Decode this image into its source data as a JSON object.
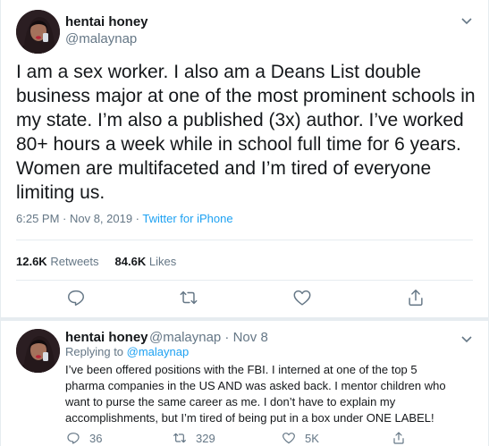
{
  "main_tweet": {
    "display_name": "hentai honey",
    "handle": "@malaynap",
    "text_lines": [
      "I am a sex worker. I also am a Deans List double",
      "business major at one of the most prominent schools in",
      "my state. I’m also a published (3x) author. I’ve worked",
      "80+ hours a week while in school full time for 6 years.",
      "Women are multifaceted and I’m tired of everyone",
      "limiting us."
    ],
    "time": "6:25 PM · Nov 8, 2019 · ",
    "source": "Twitter for iPhone",
    "retweets_count": "12.6K",
    "retweets_label": "Retweets",
    "likes_count": "84.6K",
    "likes_label": "Likes"
  },
  "reply_tweet": {
    "display_name": "hentai honey",
    "handle_time": "@malaynap · Nov 8",
    "replying_prefix": "Replying to ",
    "replying_handle": "@malaynap",
    "text_lines": [
      "I’ve been offered positions with the FBI. I interned at one of the top 5",
      "pharma companies in the US AND was asked back. I mentor children who",
      "want to purse the same career as me. I don’t have to explain my",
      "accomplishments, but I’m tired of being put in a box under ONE LABEL!"
    ],
    "reply_count": "36",
    "retweet_count": "329",
    "like_count": "5K"
  },
  "colors": {
    "link": "#1da1f2",
    "secondary_text": "#657786",
    "primary_text": "#14171a",
    "divider": "#e6ecf0"
  },
  "icons": [
    "chevron-down-icon",
    "reply-icon",
    "retweet-icon",
    "like-icon",
    "share-icon"
  ]
}
